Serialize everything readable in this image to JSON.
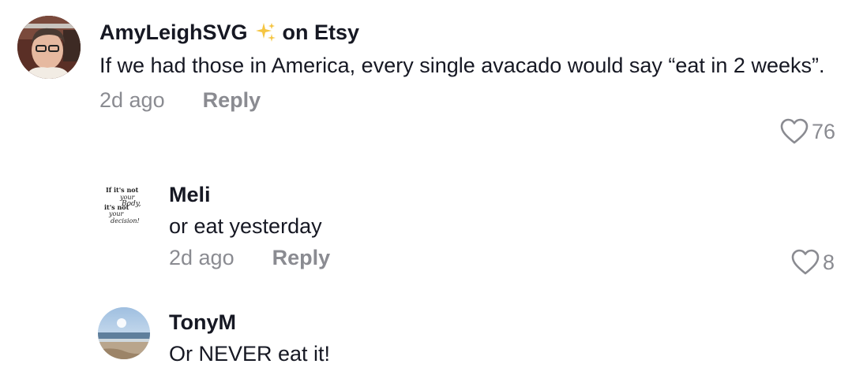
{
  "comments": [
    {
      "username": "AmyLeighSVG",
      "badge_icon": "sparkles-icon",
      "username_suffix": "on Etsy",
      "text": "If we had those in America, every single avacado would say “eat in 2 weeks”.",
      "time": "2d ago",
      "reply_label": "Reply",
      "likes": "76"
    },
    {
      "username": "Meli",
      "avatar_text": "If it's not your body, it's not your decision!",
      "text": "or eat yesterday",
      "time": "2d ago",
      "reply_label": "Reply",
      "likes": "8"
    },
    {
      "username": "TonyM",
      "text": "Or NEVER eat it!"
    }
  ],
  "colors": {
    "text": "#161823",
    "muted": "#8a8b91",
    "sparkle": "#f5c542"
  }
}
